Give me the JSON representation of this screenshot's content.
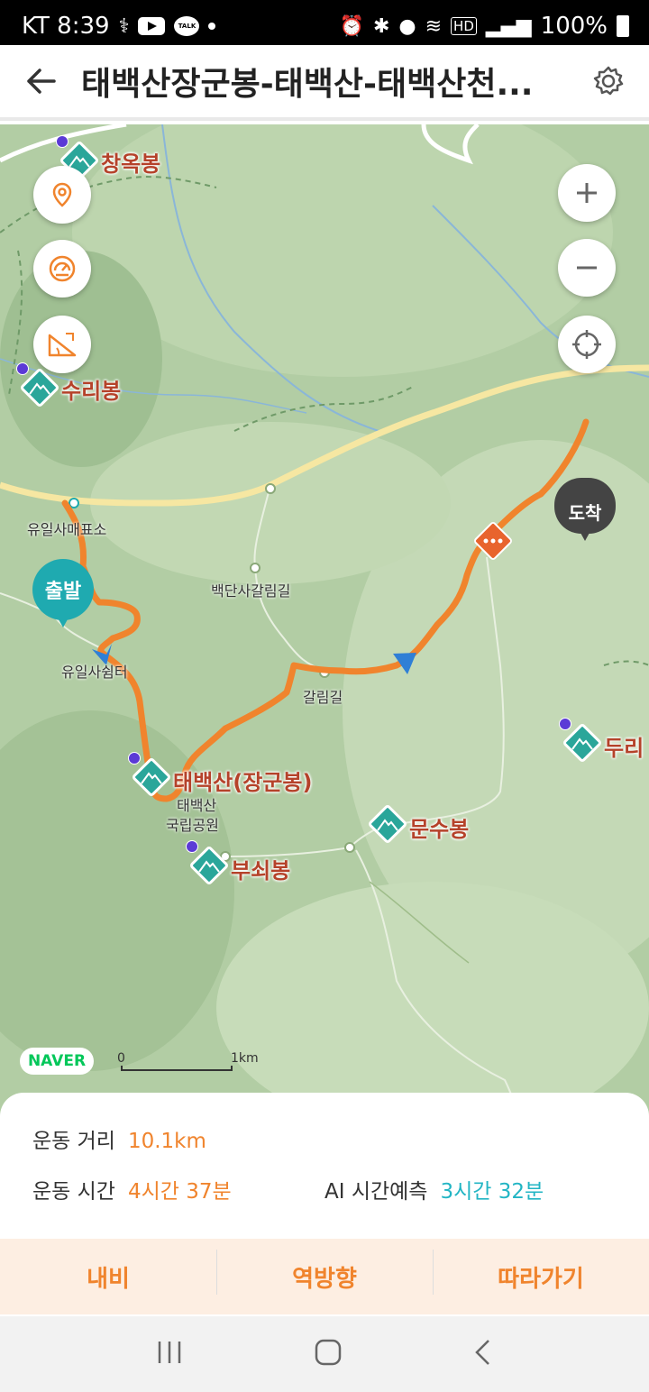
{
  "status_bar": {
    "carrier_time": "KT 8:39",
    "hd_label": "HD",
    "battery": "100%",
    "talk_label": "TALK"
  },
  "header": {
    "title": "태백산장군봉-태백산-태백산천...",
    "back_icon": "arrow-left-icon",
    "settings_icon": "gear-icon"
  },
  "map": {
    "peaks": [
      {
        "name": "창옥봉"
      },
      {
        "name": "수리봉"
      },
      {
        "name": "태백산(장군봉)"
      },
      {
        "name": "문수봉"
      },
      {
        "name": "부쇠봉"
      },
      {
        "name": "두리"
      }
    ],
    "places": {
      "ticket_office": "유일사매표소",
      "yuilsa_shelter": "유일사쉼터",
      "baekdansa": "백단사갈림길",
      "galrim": "갈림길",
      "park_1": "태백산",
      "park_2": "국립공원"
    },
    "start_label": "출발",
    "end_label": "도착",
    "naver_logo": "NAVER",
    "scale_start": "0",
    "scale_end": "1km",
    "route_color": "#f0842d"
  },
  "stats": {
    "distance_label": "운동 거리",
    "distance_value": "10.1km",
    "time_label": "운동 시간",
    "time_value": "4시간 37분",
    "ai_label": "AI 시간예측",
    "ai_value": "3시간 32분"
  },
  "actions": {
    "navi": "내비",
    "reverse": "역방향",
    "follow": "따라가기"
  },
  "navbar": {
    "recents_icon": "recents-icon",
    "home_icon": "home-icon",
    "back_icon": "back-chevron-icon"
  }
}
